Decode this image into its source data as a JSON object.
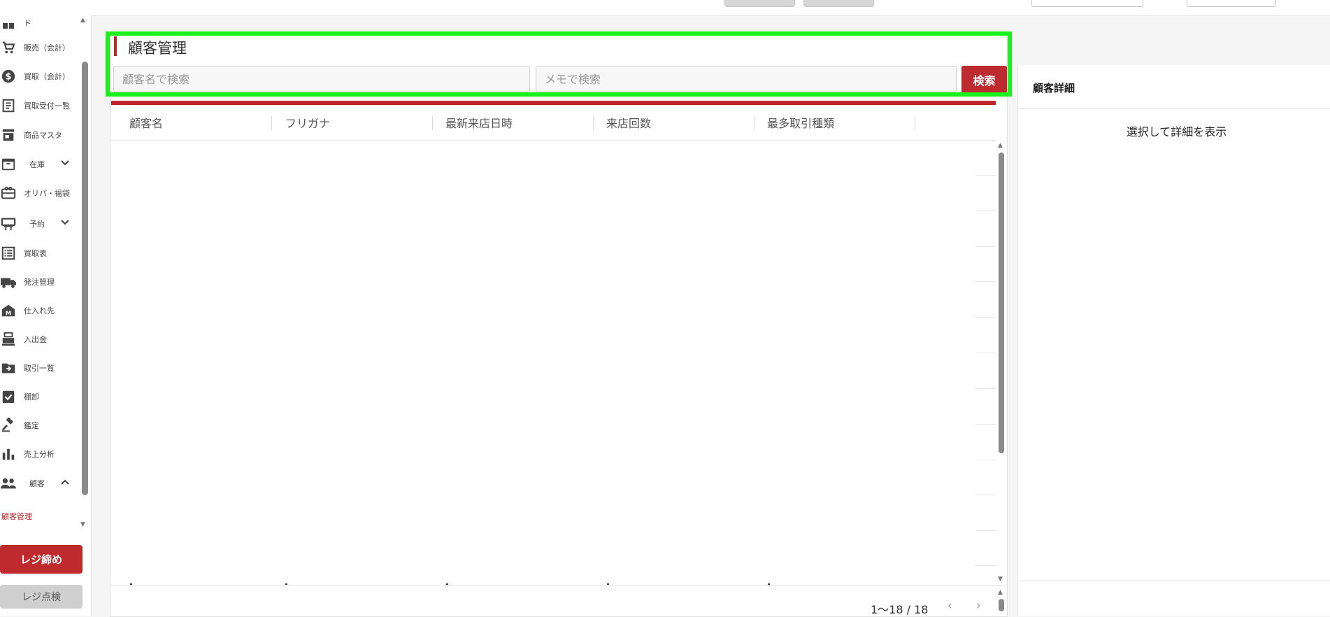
{
  "sidebar": {
    "items": [
      {
        "label": "ド",
        "icon": "dashboard-icon"
      },
      {
        "label": "販売（会計）",
        "icon": "cart-icon"
      },
      {
        "label": "買取（会計）",
        "icon": "dollar-icon"
      },
      {
        "label": "買取受付一覧",
        "icon": "receipt-icon"
      },
      {
        "label": "商品マスタ",
        "icon": "store-icon"
      },
      {
        "label": "在庫",
        "icon": "archive-icon"
      },
      {
        "label": "オリパ・福袋",
        "icon": "gift-card-icon"
      },
      {
        "label": "予約",
        "icon": "calendar-desk-icon"
      },
      {
        "label": "買取表",
        "icon": "list-icon"
      },
      {
        "label": "発注管理",
        "icon": "truck-icon"
      },
      {
        "label": "仕入れ先",
        "icon": "factory-icon"
      },
      {
        "label": "入出金",
        "icon": "register-icon"
      },
      {
        "label": "取引一覧",
        "icon": "folder-arrow-icon"
      },
      {
        "label": "棚卸",
        "icon": "clipboard-check-icon"
      },
      {
        "label": "鑑定",
        "icon": "gavel-icon"
      },
      {
        "label": "売上分析",
        "icon": "bar-chart-icon"
      },
      {
        "label": "顧客",
        "icon": "people-icon"
      }
    ],
    "active_subitem": "顧客管理",
    "close_register_label": "レジ締め",
    "check_register_label": "レジ点検"
  },
  "main": {
    "title": "顧客管理",
    "search": {
      "name_placeholder": "顧客名で検索",
      "memo_placeholder": "メモで検索",
      "button_label": "検索"
    },
    "table": {
      "columns": [
        "顧客名",
        "フリガナ",
        "最新来店日時",
        "来店回数",
        "最多取引種類"
      ]
    },
    "pagination": {
      "range": "1〜18 / 18"
    }
  },
  "detail": {
    "title": "顧客詳細",
    "empty_message": "選択して詳細を表示"
  },
  "colors": {
    "accent_red": "#c0252b",
    "highlight_green": "#19f01d"
  }
}
